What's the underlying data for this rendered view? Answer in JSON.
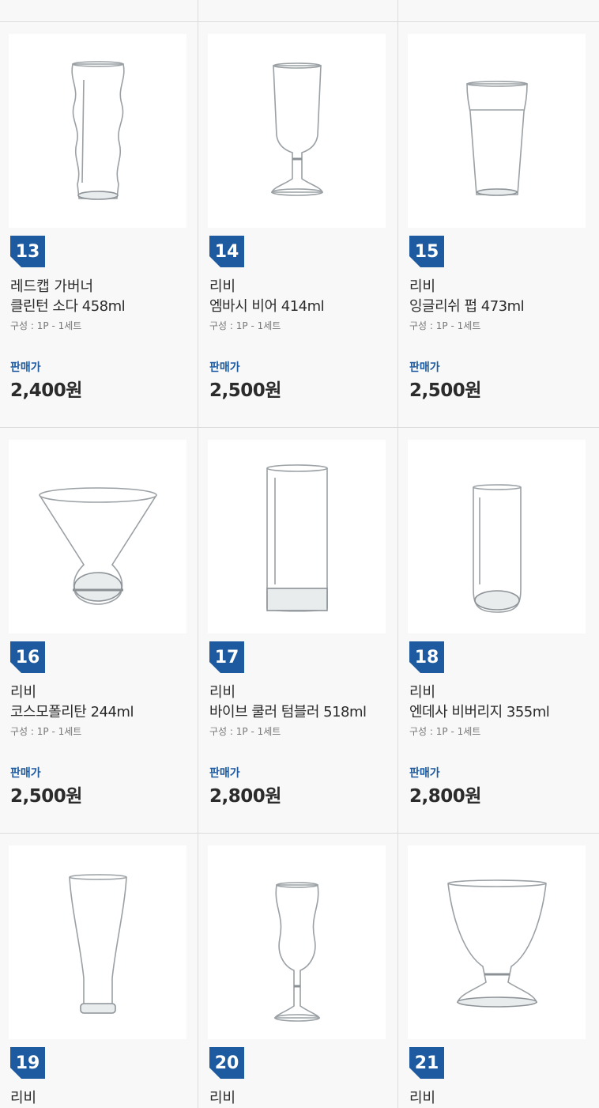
{
  "labels": {
    "price_label": "판매가"
  },
  "products": [
    {
      "no": "13",
      "brand": "레드캡 가버너",
      "name": "클린턴 소다 458ml",
      "spec": "구성 : 1P - 1세트",
      "price": "2,400원",
      "icon": "soda-glass-icon"
    },
    {
      "no": "14",
      "brand": "리비",
      "name": "엠바시 비어 414ml",
      "spec": "구성 : 1P - 1세트",
      "price": "2,500원",
      "icon": "footed-beer-glass-icon"
    },
    {
      "no": "15",
      "brand": "리비",
      "name": "잉글리쉬 펍 473ml",
      "spec": "구성 : 1P - 1세트",
      "price": "2,500원",
      "icon": "pub-glass-icon"
    },
    {
      "no": "16",
      "brand": "리비",
      "name": "코스모폴리탄 244ml",
      "spec": "구성 : 1P - 1세트",
      "price": "2,500원",
      "icon": "cosmopolitan-glass-icon"
    },
    {
      "no": "17",
      "brand": "리비",
      "name": "바이브 쿨러 텀블러 518ml",
      "spec": "구성 : 1P - 1세트",
      "price": "2,800원",
      "icon": "cooler-tumbler-icon"
    },
    {
      "no": "18",
      "brand": "리비",
      "name": "엔데사 비버리지 355ml",
      "spec": "구성 : 1P - 1세트",
      "price": "2,800원",
      "icon": "beverage-glass-icon"
    },
    {
      "no": "19",
      "brand": "리비",
      "icon": "pilsner-glass-icon"
    },
    {
      "no": "20",
      "brand": "리비",
      "icon": "footed-soda-glass-icon"
    },
    {
      "no": "21",
      "brand": "리비",
      "icon": "footed-goblet-icon"
    }
  ]
}
